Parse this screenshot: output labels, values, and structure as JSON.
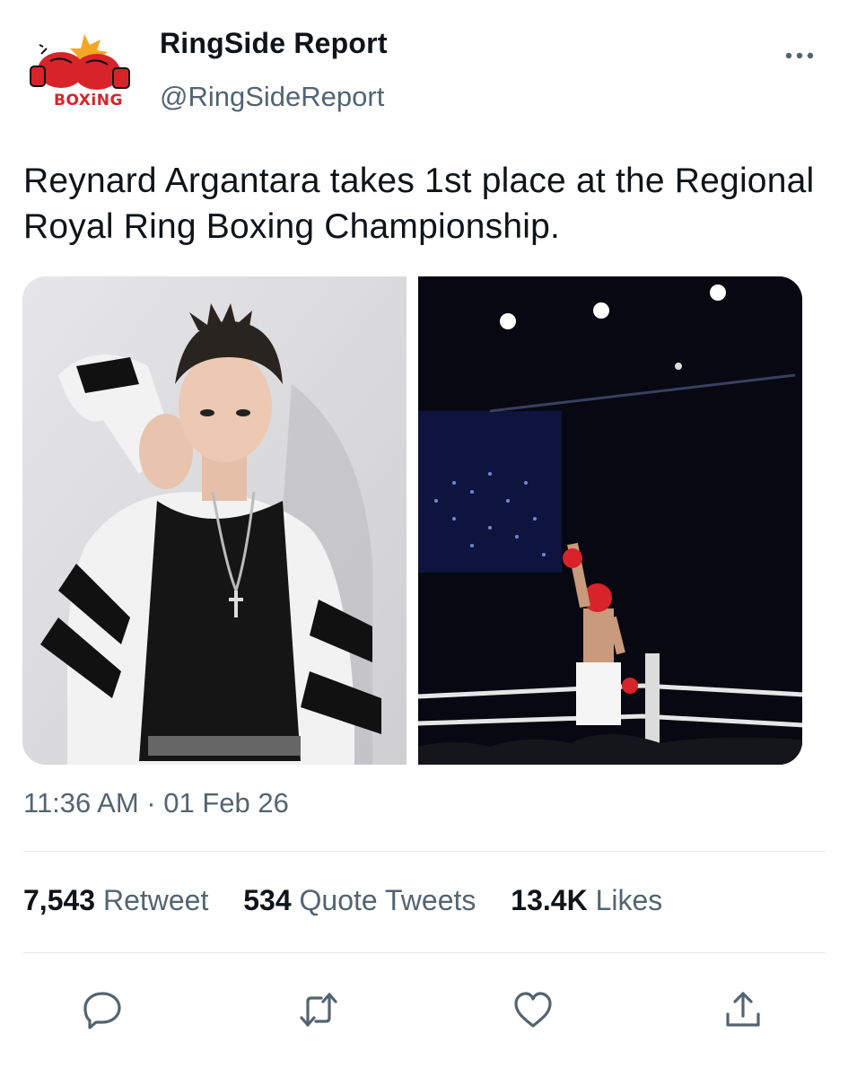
{
  "author": {
    "display_name": "RingSide Report",
    "handle": "@RingSideReport",
    "avatar_logo_text": "BOXiNG",
    "avatar_icon": "boxing-gloves-logo"
  },
  "tweet": {
    "text": "Reynard Argantara takes 1st place at the Regional Royal Ring Boxing Championship.",
    "timestamp": "11:36 AM · 01 Feb 26"
  },
  "media": [
    {
      "description_icon": "portrait-photo"
    },
    {
      "description_icon": "boxing-ring-photo"
    }
  ],
  "stats": {
    "retweets_count": "7,543",
    "retweets_label": "Retweet",
    "quotes_count": "534",
    "quotes_label": "Quote Tweets",
    "likes_count": "13.4K",
    "likes_label": "Likes"
  },
  "actions": {
    "reply_icon": "reply-icon",
    "retweet_icon": "retweet-icon",
    "like_icon": "heart-icon",
    "share_icon": "share-icon"
  },
  "colors": {
    "text_primary": "#0f1419",
    "text_secondary": "#536471",
    "divider": "#e4e8eb",
    "brand_red": "#d8232a"
  }
}
